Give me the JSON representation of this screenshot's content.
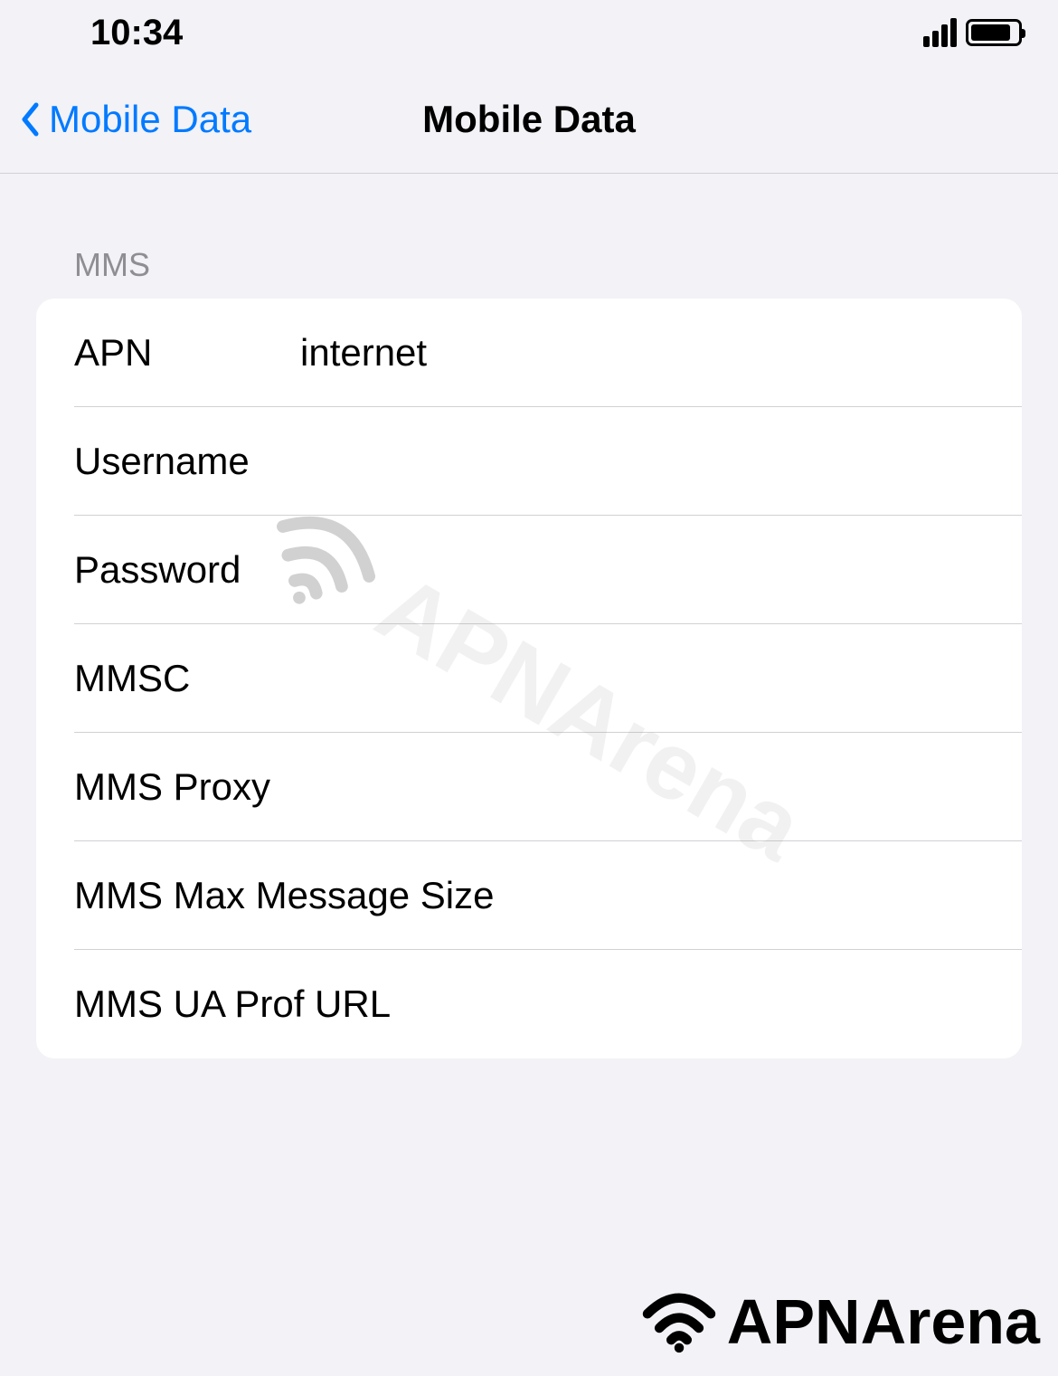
{
  "status": {
    "time": "10:34"
  },
  "nav": {
    "back_label": "Mobile Data",
    "title": "Mobile Data"
  },
  "section": {
    "header": "MMS"
  },
  "fields": {
    "apn": {
      "label": "APN",
      "value": "internet"
    },
    "username": {
      "label": "Username",
      "value": ""
    },
    "password": {
      "label": "Password",
      "value": ""
    },
    "mmsc": {
      "label": "MMSC",
      "value": ""
    },
    "mms_proxy": {
      "label": "MMS Proxy",
      "value": ""
    },
    "mms_max_size": {
      "label": "MMS Max Message Size",
      "value": ""
    },
    "mms_ua_prof": {
      "label": "MMS UA Prof URL",
      "value": ""
    }
  },
  "watermark": {
    "text": "APNArena"
  },
  "footer": {
    "text": "APNArena"
  }
}
